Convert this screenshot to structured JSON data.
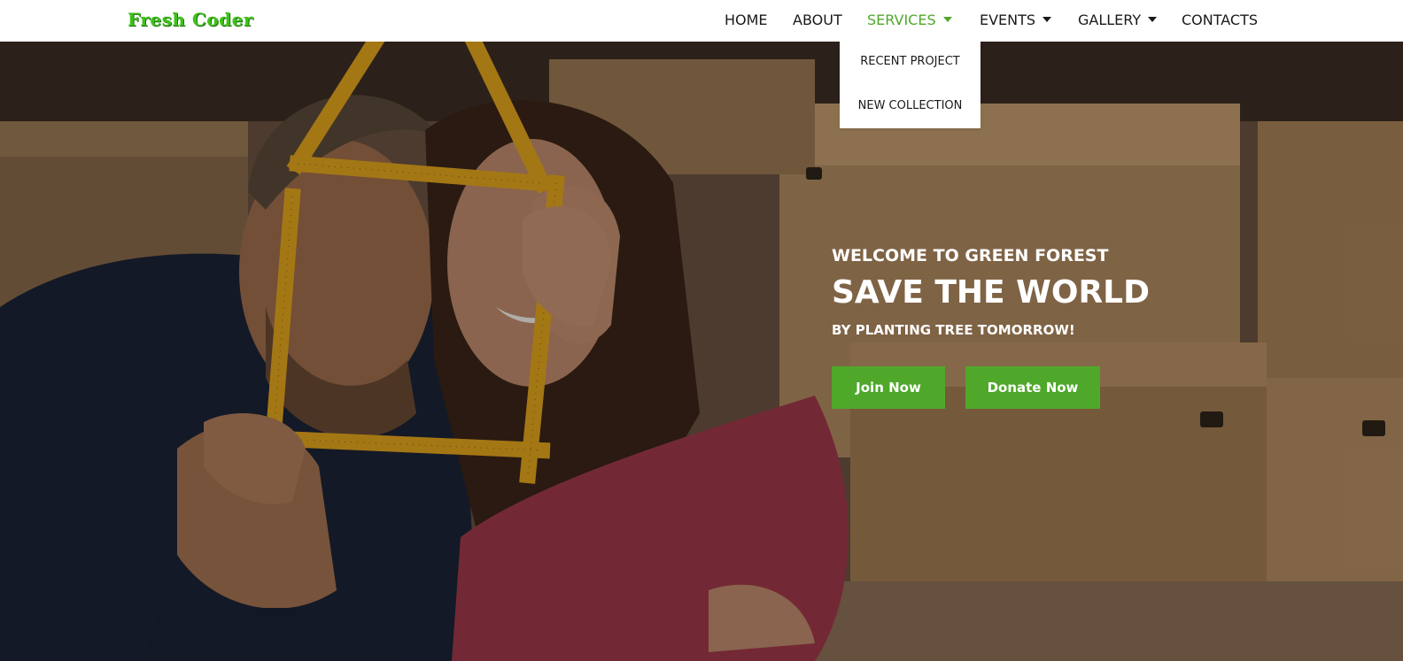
{
  "brand": {
    "logo_text": "Fresh Coder",
    "accent_color": "#4fa82a"
  },
  "nav": {
    "items": [
      {
        "label": "HOME",
        "has_caret": false
      },
      {
        "label": "ABOUT",
        "has_caret": false
      },
      {
        "label": "SERVICES",
        "has_caret": true,
        "active": true
      },
      {
        "label": "EVENTS",
        "has_caret": true
      },
      {
        "label": "GALLERY",
        "has_caret": true
      },
      {
        "label": "CONTACTS",
        "has_caret": false
      }
    ],
    "services_dropdown": [
      "RECENT PROJECT",
      "NEW COLLECTION"
    ]
  },
  "hero": {
    "welcome": "WELCOME TO GREEN FOREST",
    "headline": "SAVE THE WORLD",
    "subline": "BY PLANTING TREE TOMORROW!",
    "join_button": "Join Now",
    "donate_button": "Donate Now"
  }
}
